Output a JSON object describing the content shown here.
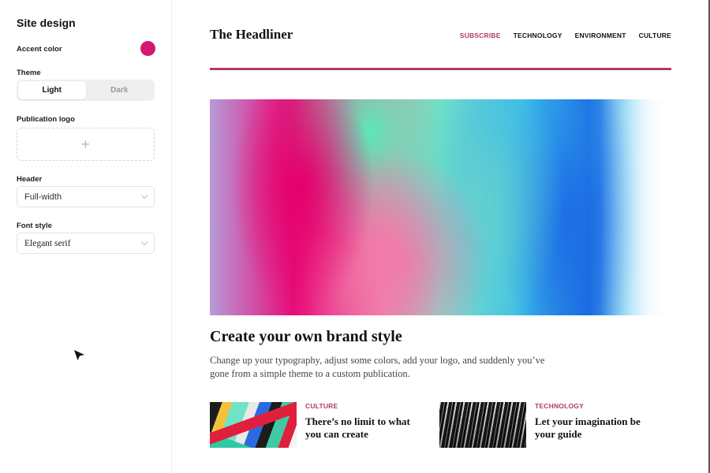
{
  "sidebar": {
    "title": "Site design",
    "accent_label": "Accent color",
    "accent_color": "#d4176f",
    "theme_label": "Theme",
    "theme_options": [
      "Light",
      "Dark"
    ],
    "theme_selected": "Light",
    "logo_label": "Publication logo",
    "logo_add_glyph": "+",
    "header_label": "Header",
    "header_value": "Full-width",
    "font_label": "Font style",
    "font_value": "Elegant serif"
  },
  "preview": {
    "site_title": "The Headliner",
    "nav": [
      {
        "label": "SUBSCRIBE",
        "accent": true
      },
      {
        "label": "TECHNOLOGY",
        "accent": false
      },
      {
        "label": "ENVIRONMENT",
        "accent": false
      },
      {
        "label": "CULTURE",
        "accent": false
      }
    ],
    "accent_color": "#b03a6c",
    "hero_image": "abstract-paint-image",
    "headline": "Create your own brand style",
    "dek": "Change up your typography, adjust some colors, add your logo, and suddenly you’ve gone from a simple theme to a custom publication.",
    "cards": [
      {
        "category": "CULTURE",
        "title": "There’s no limit to what you can create",
        "image": "abstract-shapes-image"
      },
      {
        "category": "TECHNOLOGY",
        "title": "Let your imagination be your guide",
        "image": "light-streaks-image"
      }
    ]
  }
}
